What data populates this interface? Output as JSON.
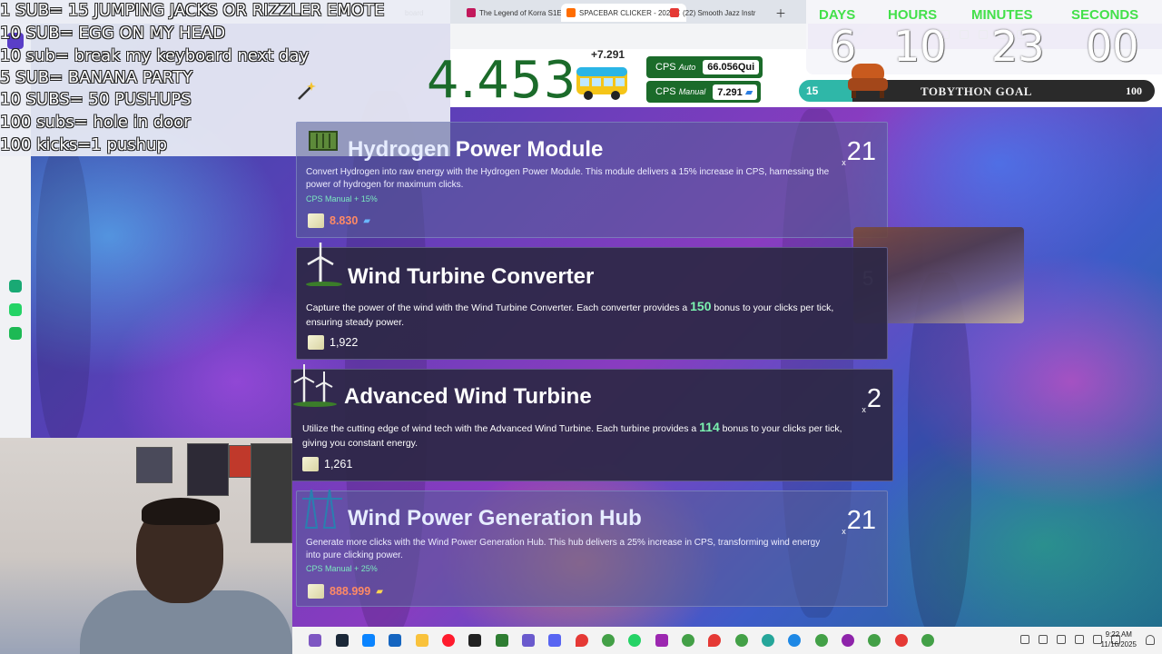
{
  "browser": {
    "tabs": [
      {
        "label": "The Legend of Korra S1E",
        "favicon": "#c2185b",
        "active": false
      },
      {
        "label": "SPACEBAR CLICKER - 202",
        "favicon": "#ff6d00",
        "active": true
      },
      {
        "label": "(22) Smooth Jazz Instr",
        "favicon": "#e53935",
        "active": false
      }
    ],
    "partial_tab_label": "board"
  },
  "sub_goals": {
    "lines": [
      "1 SUB= 15 JUMPING JACKS OR RIZZLER EMOTE",
      "10 SUB= EGG ON MY HEAD",
      "10 sub= break my keyboard next day",
      "5 SUB= BANANA  PARTY",
      "10 SUBS= 50 PUSHUPS",
      "100 subs= hole in door",
      "100 kicks=1 pushup"
    ]
  },
  "game": {
    "counter": "4.453",
    "delta": "+7.291",
    "cps_auto_label": "CPS",
    "cps_auto_word": "Auto",
    "cps_auto_value": "66.056Qui",
    "cps_manual_label": "CPS",
    "cps_manual_word": "Manual",
    "cps_manual_value": "7.291"
  },
  "subathon": {
    "labels": [
      "DAYS",
      "HOURS",
      "MINUTES",
      "SECONDS"
    ],
    "values": [
      "6",
      "10",
      "23",
      "00"
    ],
    "goal_title": "TOBYTHON GOAL",
    "goal_current": "15",
    "goal_target": "100",
    "goal_progress": 0.15
  },
  "upgrades": [
    {
      "title_a": "Hydrogen ",
      "title_b": "Power Module",
      "desc": "Convert Hydrogen into raw energy with the Hydrogen Power Module. This module delivers a 15% increase in CPS, harnessing the power of hydrogen for maximum clicks.",
      "subline": "CPS Manual + 15%",
      "cost": "8.830",
      "count": "21",
      "count_prefix": "x"
    },
    {
      "title": "Wind Turbine Converter",
      "desc_a": "Capture the power of the wind with the Wind Turbine Converter. Each converter provides a ",
      "bonus": "150",
      "desc_b": " bonus to your clicks per tick, ensuring steady power.",
      "cost": "1,922"
    },
    {
      "title": "Advanced Wind Turbine",
      "desc_a": "Utilize the cutting edge of wind tech with the Advanced Wind Turbine. Each turbine provides a ",
      "bonus": "114",
      "desc_b": " bonus to your clicks per tick, giving you constant energy.",
      "cost": "1,261",
      "count": "2",
      "count_prefix": "x"
    },
    {
      "title": "Wind Power Generation Hub",
      "desc": "Generate more clicks with the Wind Power Generation Hub. This hub delivers a 25% increase in CPS, transforming wind energy into pure clicking power.",
      "subline": "CPS Manual + 25%",
      "cost": "888.999",
      "count": "21",
      "count_prefix": "x"
    }
  ],
  "stream_overlay_number": "5",
  "taskbar": {
    "time": "9:22 AM",
    "date": "11/16/2025"
  },
  "colors": {
    "accent_green": "#1b6b2a",
    "timer_label_green": "#43e04a",
    "bonus_green": "#7bf2b0",
    "locked_cost_orange": "#ff8a65"
  }
}
